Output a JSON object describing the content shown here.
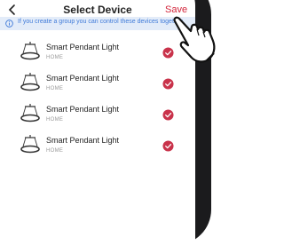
{
  "header": {
    "title": "Select Device",
    "save_label": "Save"
  },
  "banner": {
    "text": "If you create a group you can control these devices together."
  },
  "devices": [
    {
      "name": "Smart Pendant Light",
      "room": "HOME",
      "selected": true
    },
    {
      "name": "Smart Pendant Light",
      "room": "HOME",
      "selected": true
    },
    {
      "name": "Smart Pendant Light",
      "room": "HOME",
      "selected": true
    },
    {
      "name": "Smart Pendant Light",
      "room": "HOME",
      "selected": true
    }
  ],
  "colors": {
    "accent": "#d2243a",
    "banner_bg": "#e3ecf9",
    "banner_text": "#3f7ad8",
    "check": "#c9334b"
  },
  "icons": [
    "back-icon",
    "info-icon",
    "pendant-lamp-icon",
    "check-circle-icon",
    "pointing-hand-icon"
  ]
}
